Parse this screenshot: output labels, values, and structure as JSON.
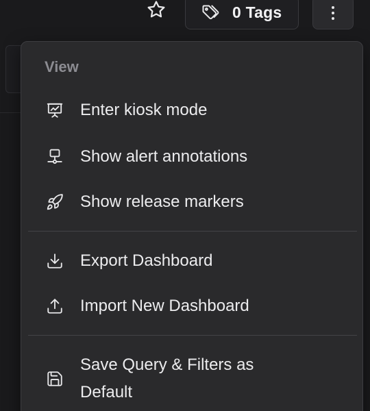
{
  "toolbar": {
    "star_icon": "star-icon",
    "tags_label": "0 Tags",
    "tags_icon": "tag-icon",
    "more_icon": "more-vertical-icon"
  },
  "menu": {
    "section_view": "View",
    "items": [
      {
        "label": "Enter kiosk mode",
        "icon": "presentation-icon"
      },
      {
        "label": "Show alert annotations",
        "icon": "network-icon"
      },
      {
        "label": "Show release markers",
        "icon": "rocket-icon"
      },
      {
        "label": "Export Dashboard",
        "icon": "download-icon"
      },
      {
        "label": "Import New Dashboard",
        "icon": "upload-icon"
      },
      {
        "label": "Save Query & Filters as Default",
        "icon": "save-icon"
      }
    ]
  },
  "colors": {
    "background": "#1a1a1c",
    "menu_bg": "#2a2a2c",
    "text": "#ececee",
    "muted": "#8c8c92"
  }
}
